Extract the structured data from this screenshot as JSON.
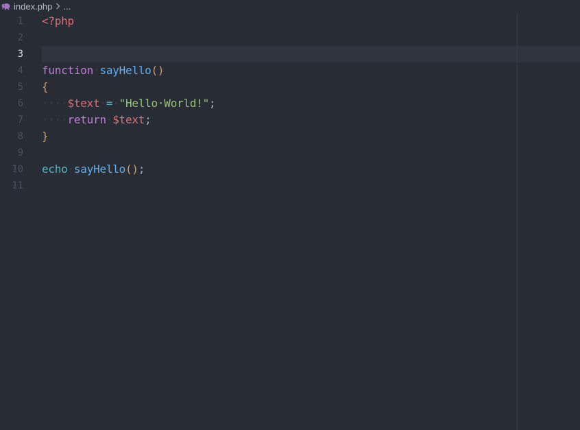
{
  "breadcrumb": {
    "icon": "php-elephant-icon",
    "file": "index.php",
    "more": "..."
  },
  "editor": {
    "active_line": 3,
    "line_numbers": [
      "1",
      "2",
      "3",
      "4",
      "5",
      "6",
      "7",
      "8",
      "9",
      "10",
      "11"
    ],
    "lines": [
      [
        {
          "t": "<?php",
          "c": "tag"
        }
      ],
      [],
      [],
      [
        {
          "t": "function",
          "c": "kw"
        },
        {
          "t": "·",
          "c": "ws"
        },
        {
          "t": "sayHello",
          "c": "fn"
        },
        {
          "t": "()",
          "c": "paren"
        }
      ],
      [
        {
          "t": "{",
          "c": "brace"
        }
      ],
      [
        {
          "t": "····",
          "c": "ws"
        },
        {
          "t": "$text",
          "c": "var"
        },
        {
          "t": "·",
          "c": "ws"
        },
        {
          "t": "=",
          "c": "op"
        },
        {
          "t": "·",
          "c": "ws"
        },
        {
          "t": "\"Hello·World!\"",
          "c": "str"
        },
        {
          "t": ";",
          "c": "punc"
        }
      ],
      [
        {
          "t": "····",
          "c": "ws"
        },
        {
          "t": "return",
          "c": "kw"
        },
        {
          "t": "·",
          "c": "ws"
        },
        {
          "t": "$text",
          "c": "var"
        },
        {
          "t": ";",
          "c": "punc"
        }
      ],
      [
        {
          "t": "}",
          "c": "brace"
        }
      ],
      [],
      [
        {
          "t": "echo",
          "c": "echo"
        },
        {
          "t": "·",
          "c": "ws"
        },
        {
          "t": "sayHello",
          "c": "fn"
        },
        {
          "t": "()",
          "c": "paren"
        },
        {
          "t": ";",
          "c": "punc"
        }
      ],
      []
    ]
  },
  "colors": {
    "background": "#282c34",
    "tag": "#e06c75",
    "keyword": "#c678dd",
    "function": "#61afef",
    "string": "#98c379",
    "operator": "#56b6c2",
    "bracket": "#d19a66"
  }
}
